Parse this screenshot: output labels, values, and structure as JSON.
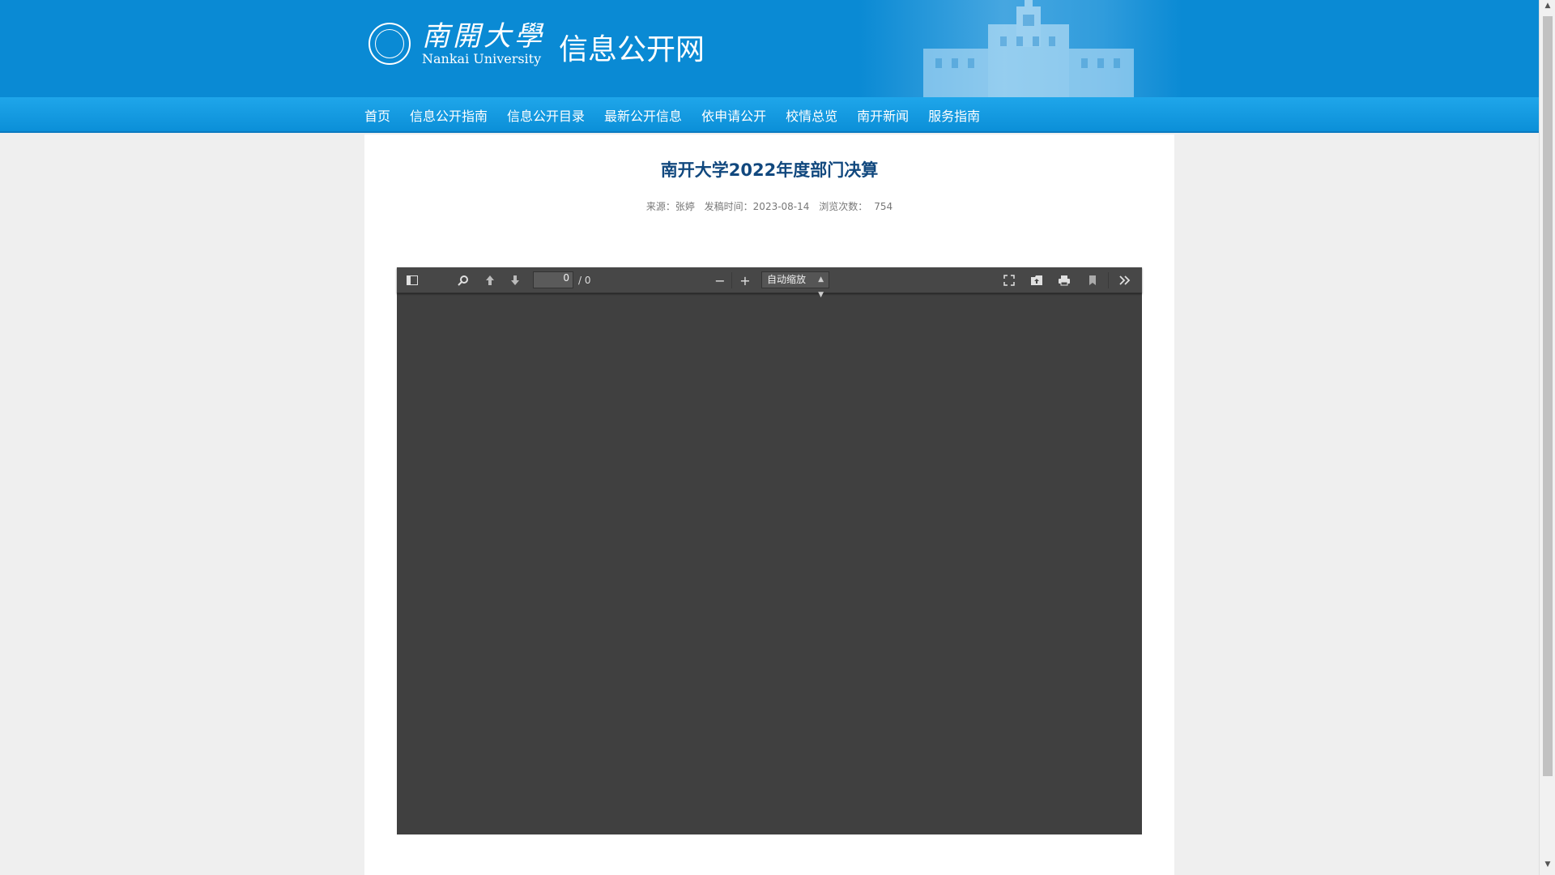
{
  "header": {
    "logo_cn": "南開大學",
    "logo_en": "Nankai University",
    "site_name": "信息公开网"
  },
  "nav": {
    "items": [
      "首页",
      "信息公开指南",
      "信息公开目录",
      "最新公开信息",
      "依申请公开",
      "校情总览",
      "南开新闻",
      "服务指南"
    ]
  },
  "article": {
    "title": "南开大学2022年度部门决算",
    "source": "来源：张婷",
    "date": "发稿时间：2023-08-14",
    "views_label": "浏览次数：",
    "views": "754"
  },
  "viewer": {
    "page_value": "0",
    "page_count": "/ 0",
    "zoom": "自动缩放",
    "icons": [
      "sidebar-toggle-icon",
      "search-icon",
      "previous-page-icon",
      "next-page-icon",
      "zoom-out-icon",
      "zoom-in-icon",
      "presentation-mode-icon",
      "open-file-icon",
      "print-icon",
      "bookmark-icon",
      "tools-icon"
    ]
  }
}
